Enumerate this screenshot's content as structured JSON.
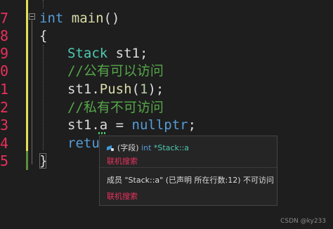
{
  "editor": {
    "line_numbers": [
      "7",
      "8",
      "9",
      "0",
      "1",
      "2",
      "3",
      "4",
      "5"
    ],
    "lines": [
      {
        "parts": [
          "int",
          " main",
          "()"
        ]
      },
      {
        "parts": [
          "{"
        ]
      },
      {
        "parts": [
          "Stack",
          " st1;"
        ]
      },
      {
        "parts": [
          "//公有可以访问"
        ]
      },
      {
        "parts": [
          "st1.",
          "Push",
          "(",
          "1",
          ");"
        ]
      },
      {
        "parts": [
          "//私有不可访问"
        ]
      },
      {
        "parts": [
          "st1.",
          "a",
          " = ",
          "nullptr",
          ";"
        ]
      },
      {
        "parts": [
          "retu"
        ]
      },
      {
        "parts": [
          "}"
        ]
      }
    ]
  },
  "colors": {
    "background": "#1e1e1e",
    "line_number": "#e8315b",
    "keyword": "#569cd6",
    "comment": "#57a64a",
    "type": "#4ec9b0",
    "function": "#dcdcaa",
    "number": "#b5cea8",
    "change_bar_yellow": "#e5e05a",
    "change_bar_green": "#5c8f3a"
  },
  "tooltip": {
    "icon": "field-icon",
    "kind": "(字段)",
    "type_kw": "int",
    "member": " *Stack::a",
    "online_search_1": "联机搜索",
    "message": "成员 \"Stack::a\" (已声明 所在行数:12) 不可访问",
    "online_search_2": "联机搜索"
  },
  "watermark": "CSDN @ky233"
}
